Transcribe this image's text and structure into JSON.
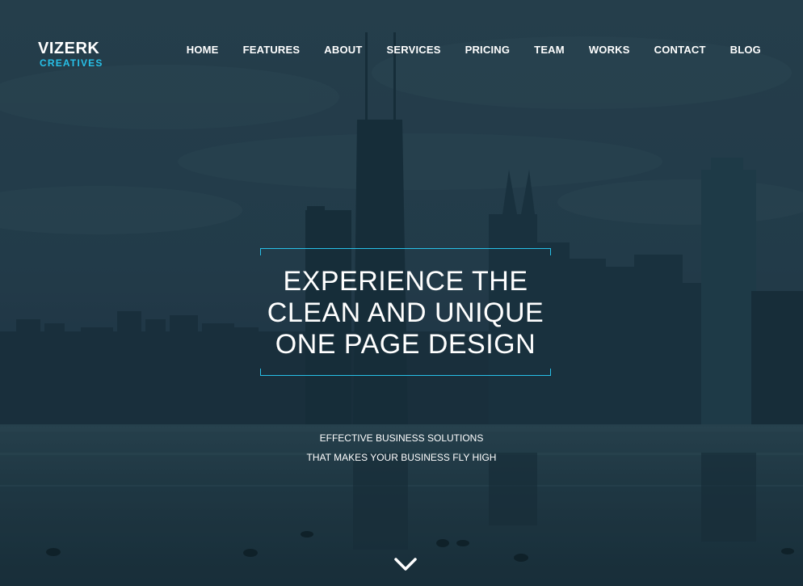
{
  "brand": {
    "name": "VIZERK",
    "tagline": "CREATIVES"
  },
  "nav": {
    "items": [
      {
        "label": "HOME"
      },
      {
        "label": "FEATURES"
      },
      {
        "label": "ABOUT"
      },
      {
        "label": "SERVICES"
      },
      {
        "label": "PRICING"
      },
      {
        "label": "TEAM"
      },
      {
        "label": "WORKS"
      },
      {
        "label": "CONTACT"
      },
      {
        "label": "BLOG"
      }
    ]
  },
  "hero": {
    "headline_lines": [
      "EXPERIENCE THE",
      "CLEAN AND UNIQUE",
      "ONE PAGE DESIGN"
    ],
    "sub_lines": [
      "EFFECTIVE BUSINESS SOLUTIONS",
      "THAT MAKES YOUR BUSINESS FLY HIGH"
    ],
    "scroll_icon": "chevron-down-icon"
  },
  "colors": {
    "accent": "#27c0e8",
    "text": "#ffffff",
    "background": "#1f3845"
  }
}
